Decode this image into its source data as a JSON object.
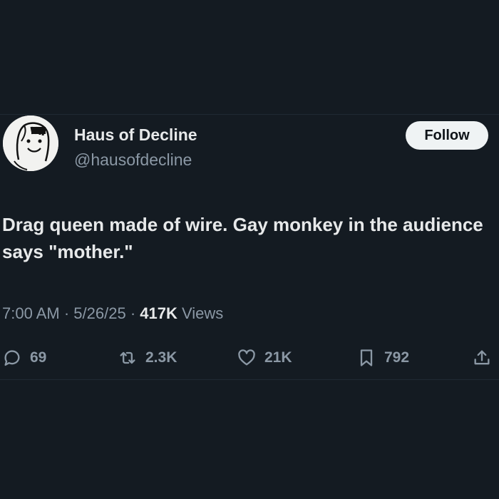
{
  "user": {
    "display_name": "Haus of Decline",
    "handle": "@hausofdecline",
    "follow_label": "Follow"
  },
  "post": {
    "text": "Drag queen made of wire. Gay monkey in the audience says \"mother.\"",
    "time": "7:00 AM",
    "date": "5/26/25",
    "views_count": "417K",
    "views_label": "Views"
  },
  "actions": {
    "replies": "69",
    "reposts": "2.3K",
    "likes": "21K",
    "bookmarks": "792"
  },
  "colors": {
    "background": "#141b22",
    "text_primary": "#e7e9ea",
    "text_secondary": "#8b98a5",
    "follow_button": "#eff3f4"
  },
  "icons": [
    "reply-icon",
    "repost-icon",
    "like-icon",
    "bookmark-icon",
    "share-icon"
  ]
}
